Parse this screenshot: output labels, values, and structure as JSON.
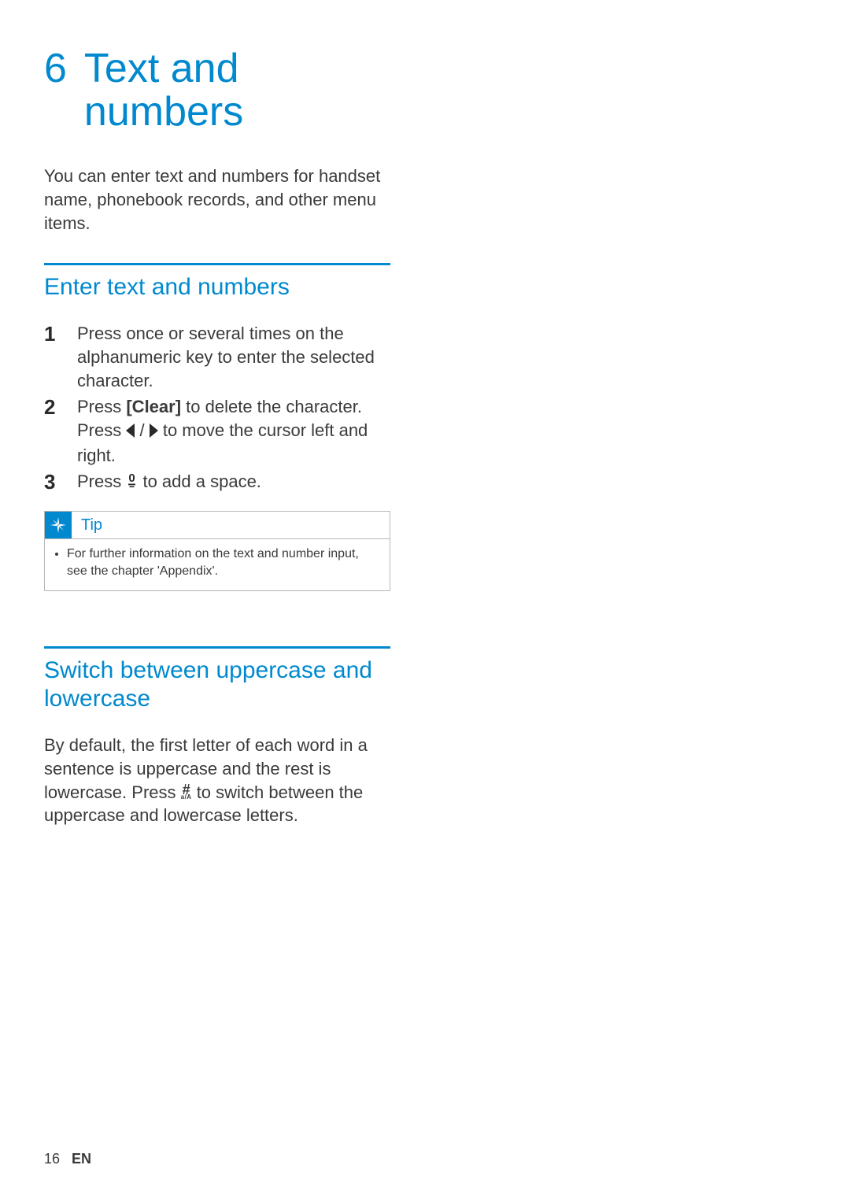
{
  "chapter": {
    "number": "6",
    "title": "Text and numbers"
  },
  "intro": "You can enter text and numbers for handset name, phonebook records, and other menu items.",
  "section1": {
    "heading": "Enter text and numbers",
    "steps": {
      "s1": {
        "num": "1",
        "text": "Press once or several times on the alphanumeric key to enter the selected character."
      },
      "s2": {
        "num": "2",
        "text_a": "Press ",
        "clear": "[Clear]",
        "text_b": " to delete the character. Press ",
        "text_c": " to move the cursor left and right."
      },
      "s3": {
        "num": "3",
        "text_a": "Press ",
        "text_b": " to add a space."
      }
    },
    "tip": {
      "label": "Tip",
      "text": "For further information on the text and number input, see the chapter 'Appendix'."
    }
  },
  "section2": {
    "heading": "Switch between uppercase and lowercase",
    "body_a": "By default, the first letter of each word in a sentence is uppercase and the rest is lowercase. Press ",
    "body_b": " to switch between the uppercase and lowercase letters."
  },
  "footer": {
    "page": "16",
    "lang": "EN"
  }
}
